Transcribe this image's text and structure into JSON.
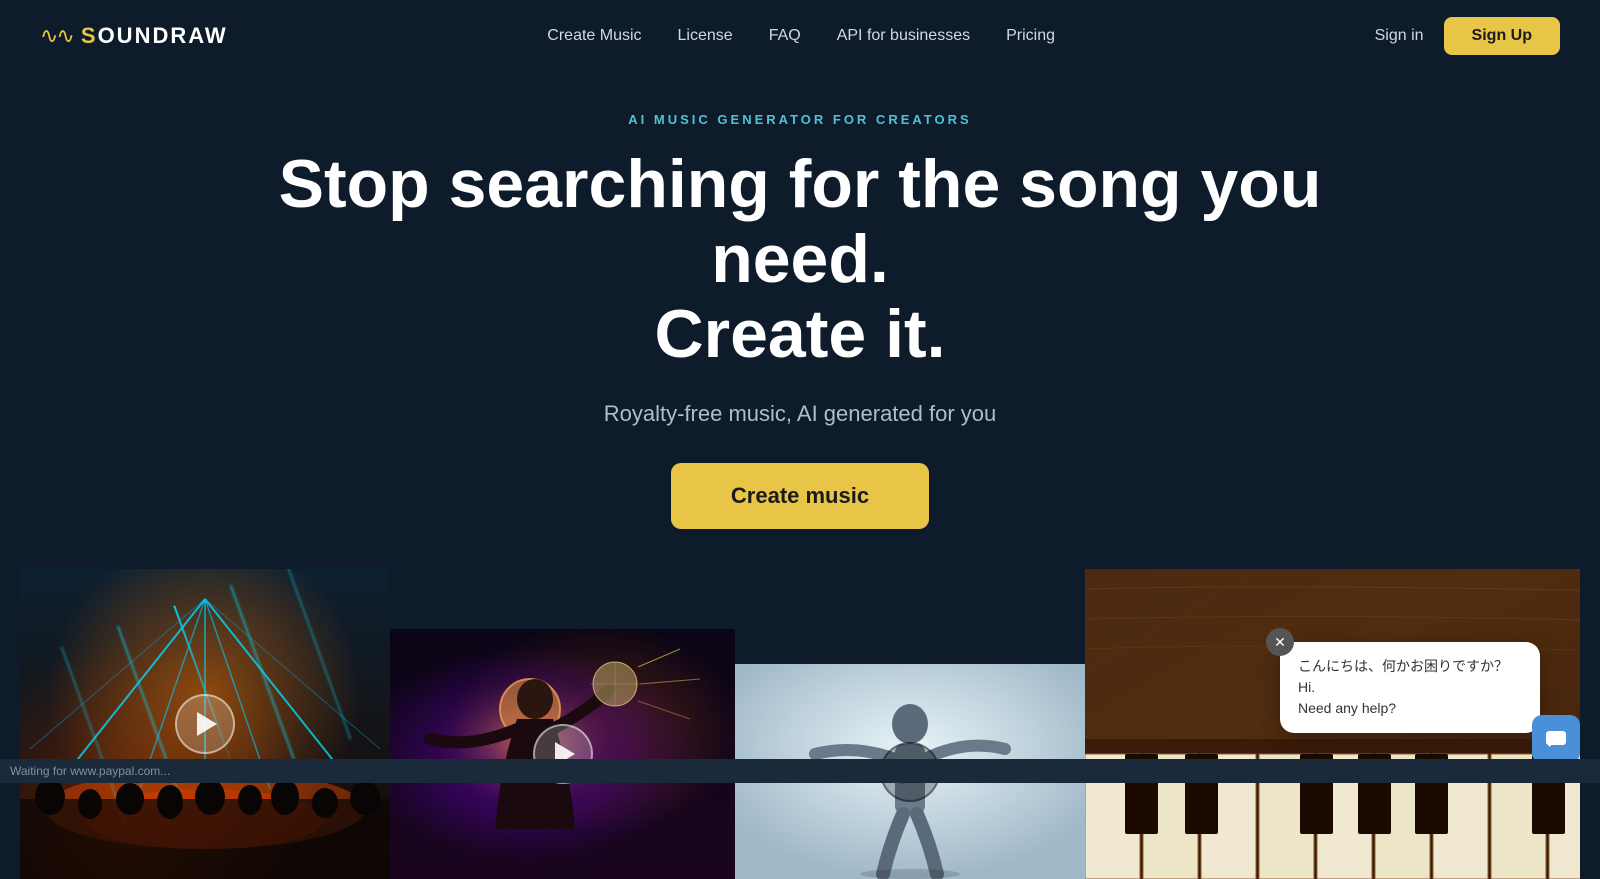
{
  "brand": {
    "logo_symbol": "∿∿",
    "logo_name_prefix": "S",
    "logo_name_rest": "OUNDRAW"
  },
  "nav": {
    "links": [
      {
        "id": "create-music",
        "label": "Create Music"
      },
      {
        "id": "license",
        "label": "License"
      },
      {
        "id": "faq",
        "label": "FAQ"
      },
      {
        "id": "api",
        "label": "API for businesses"
      },
      {
        "id": "pricing",
        "label": "Pricing"
      }
    ],
    "sign_in": "Sign in",
    "sign_up": "Sign Up"
  },
  "hero": {
    "tag": "AI MUSIC GENERATOR FOR CREATORS",
    "title_line1": "Stop searching for the song you need.",
    "title_line2": "Create it.",
    "subtitle": "Royalty-free music, AI generated for you",
    "cta_button": "Create music"
  },
  "thumbnails": [
    {
      "id": "concert",
      "label": "Concert scene"
    },
    {
      "id": "disco",
      "label": "Disco performer"
    },
    {
      "id": "dancer",
      "label": "Dancer"
    },
    {
      "id": "piano",
      "label": "Piano"
    }
  ],
  "chat": {
    "message_line1": "こんにちは、何かお困りですか？Hi.",
    "message_line2": "Need any help?"
  },
  "status": {
    "text": "Waiting for www.paypal.com..."
  },
  "colors": {
    "bg": "#0d1b2a",
    "accent": "#e8c547",
    "teal": "#4fc3d4",
    "nav_text": "#d0d8e4"
  }
}
